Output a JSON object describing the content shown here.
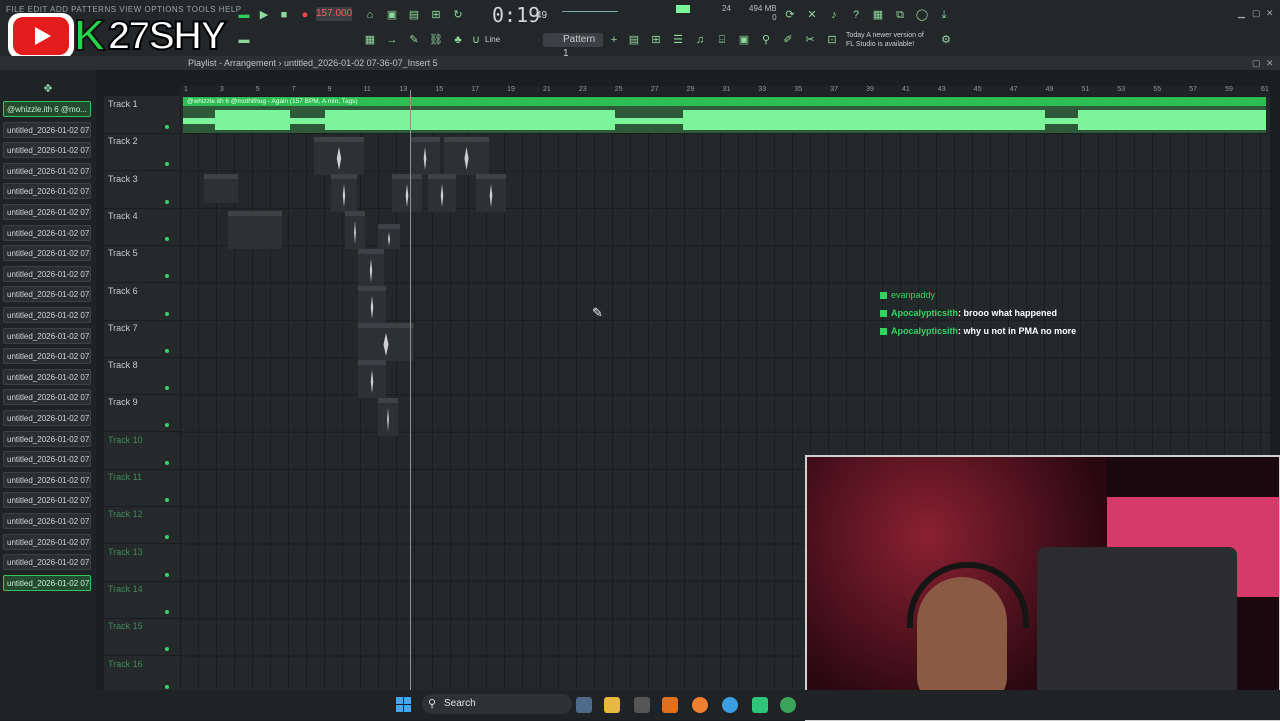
{
  "menu": {
    "items": "FILE  EDIT  ADD  PATTERNS  VIEW  OPTIONS  TOOLS  HELP"
  },
  "branding": {
    "channel": "27SHY",
    "k_letter": "K"
  },
  "transport": {
    "tempo": "157.000",
    "time": "0:19",
    "time_sub": "49",
    "memory": "494 MB",
    "cpu": "24",
    "voices": "0"
  },
  "toolbar": {
    "snap_mode": "Line",
    "pattern": "Pattern 1",
    "news_line1": "Today  A newer version of",
    "news_line2": "FL Studio is available!"
  },
  "playlist": {
    "title": "Playlist - Arrangement  ›  untitled_2026-01-02 07-36-07_Insert 5"
  },
  "main_clip_label": "@whizzle.ith 6 @mothithug - Again (157 BPM, A min, Tags)",
  "browser": {
    "items": [
      "@whizzle.ith 6 @mo...",
      "untitled_2026-01-02 07-...",
      "untitled_2026-01-02 07-...",
      "untitled_2026-01-02 07-...",
      "untitled_2026-01-02 07-...",
      "untitled_2026-01-02 07-...",
      "untitled_2026-01-02 07-...",
      "untitled_2026-01-02 07-...",
      "untitled_2026-01-02 07-...",
      "untitled_2026-01-02 07-...",
      "untitled_2026-01-02 07-...",
      "untitled_2026-01-02 07-...",
      "untitled_2026-01-02 07-...",
      "untitled_2026-01-02 07-...",
      "untitled_2026-01-02 07-...",
      "untitled_2026-01-02 07-...",
      "untitled_2026-01-02 07-...",
      "untitled_2026-01-02 07-...",
      "untitled_2026-01-02 07-...",
      "untitled_2026-01-02 07-...",
      "untitled_2026-01-02 07-...",
      "untitled_2026-01-02 07-...",
      "untitled_2026-01-02 07-...",
      "untitled_2026-01-02 07-..."
    ]
  },
  "tracks": [
    "Track 1",
    "Track 2",
    "Track 3",
    "Track 4",
    "Track 5",
    "Track 6",
    "Track 7",
    "Track 8",
    "Track 9",
    "Track 10",
    "Track 11",
    "Track 12",
    "Track 13",
    "Track 14",
    "Track 15",
    "Track 16"
  ],
  "ruler": [
    "1",
    "3",
    "5",
    "7",
    "9",
    "11",
    "13",
    "15",
    "17",
    "19",
    "21",
    "23",
    "25",
    "27",
    "29",
    "31",
    "33",
    "35",
    "37",
    "39",
    "41",
    "43",
    "45",
    "47",
    "49",
    "51",
    "53",
    "55",
    "57",
    "59",
    "61"
  ],
  "chat": [
    {
      "user": "evanpaddy",
      "msg": ""
    },
    {
      "user": "Apocalypticsith",
      "msg": ": brooo what happened"
    },
    {
      "user": "Apocalypticsith",
      "msg": ": why u not in PMA no more"
    }
  ],
  "taskbar": {
    "search": "Search"
  },
  "colors": {
    "accent": "#35d462",
    "background": "#1b1e20",
    "clip_header": "#2ebd52"
  }
}
